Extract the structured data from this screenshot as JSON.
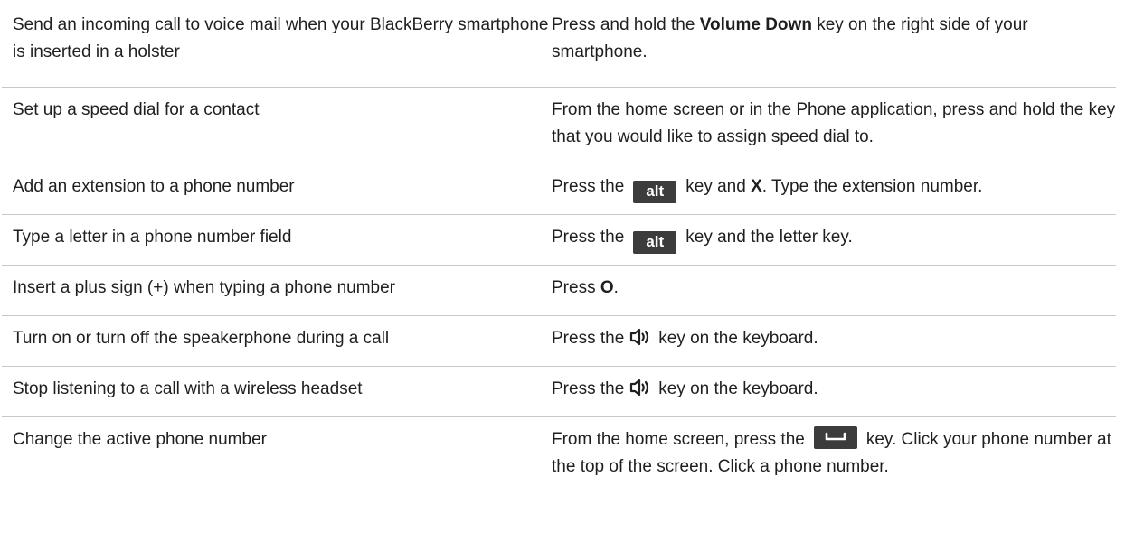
{
  "rows": [
    {
      "action": "Send an incoming call to voice mail when your BlackBerry smartphone is inserted in a holster",
      "instruction": {
        "pre": "Press and hold the ",
        "bold": "Volume Down",
        "post": " key on the right side of your smartphone."
      }
    },
    {
      "action": "Set up a speed dial for a contact",
      "instruction": {
        "text": "From the home screen or in the Phone application, press and hold the key that you would like to assign speed dial to."
      }
    },
    {
      "action": "Add an extension to a phone number",
      "instruction": {
        "pre": "Press the",
        "key": "alt",
        "mid": "key and ",
        "bold": "X",
        "post": ". Type the extension number."
      }
    },
    {
      "action": "Type a letter in a phone number field",
      "instruction": {
        "pre": "Press the",
        "key": "alt",
        "post": "key and the letter key."
      }
    },
    {
      "action": "Insert a plus sign (+) when typing a phone number",
      "instruction": {
        "pre": "Press ",
        "bold": "O",
        "post": "."
      }
    },
    {
      "action": "Turn on or turn off the speakerphone during a call",
      "instruction": {
        "pre": "Press the",
        "icon": "speakerphone-icon",
        "post": "key on the keyboard."
      }
    },
    {
      "action": "Stop listening to a call with a wireless headset",
      "instruction": {
        "pre": "Press the",
        "icon": "speakerphone-icon",
        "post": "key on the keyboard."
      }
    },
    {
      "action": "Change the active phone number",
      "instruction": {
        "pre": "From the home screen, press the",
        "icon": "send-key-icon",
        "post": "key. Click your phone number at the top of the screen. Click a phone number."
      }
    }
  ],
  "colors": {
    "text": "#1f1f1f",
    "divider": "#c8c8c8",
    "key_background": "#3c3c3c"
  }
}
